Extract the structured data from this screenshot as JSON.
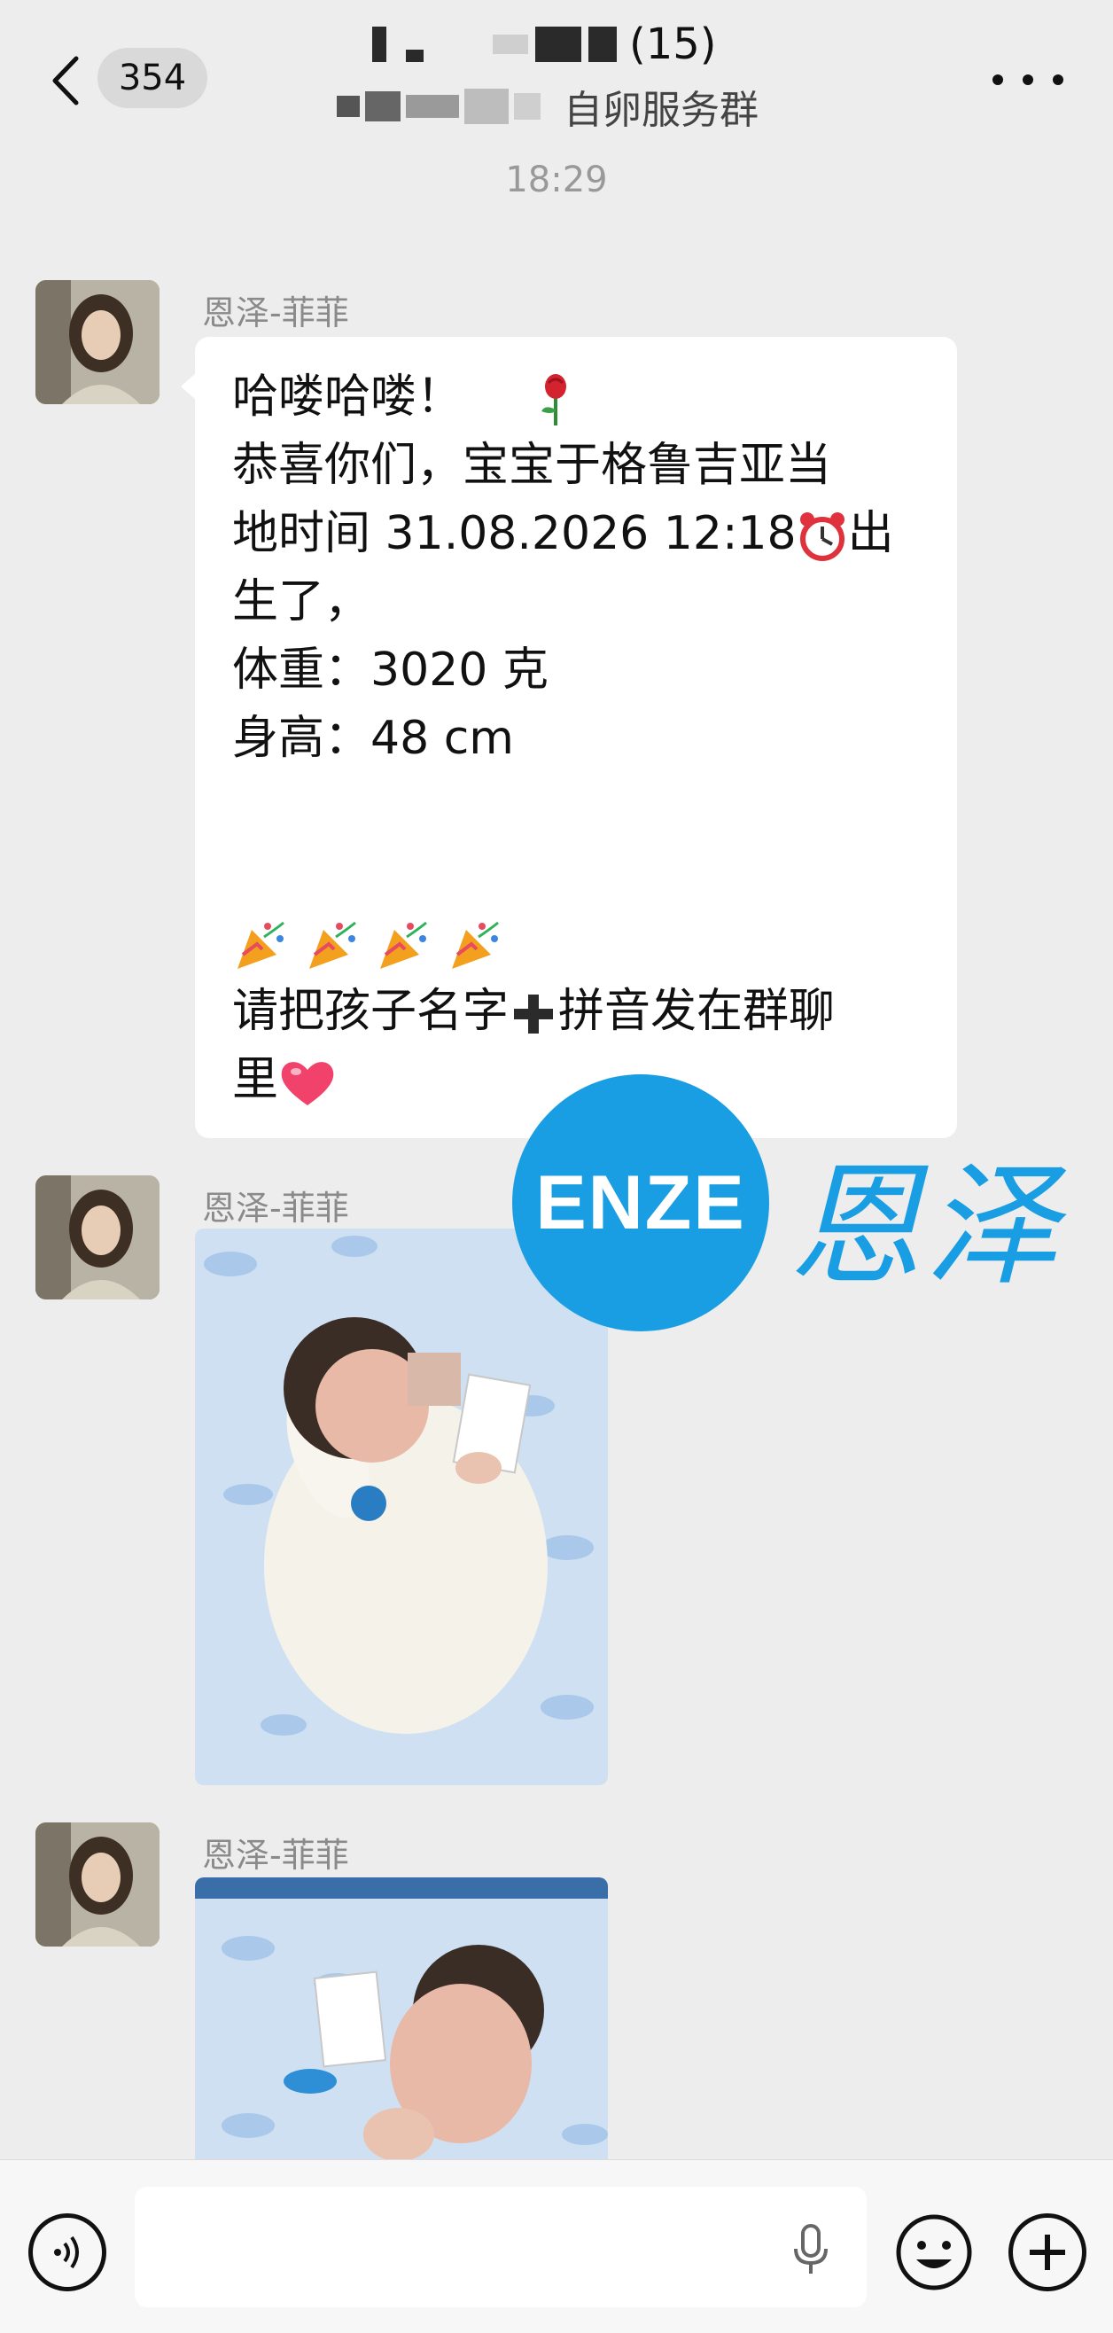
{
  "header": {
    "unread_count": "354",
    "title_count": "(15)",
    "title_sub": "自卵服务群",
    "back_icon": "chevron-left-icon",
    "more_icon": "more-dots-icon"
  },
  "chat": {
    "timestamp": "18:29",
    "messages": [
      {
        "sender": "恩泽-菲菲",
        "type": "text",
        "lines": [
          "哈喽哈喽！",
          "恭喜你们，宝宝于格鲁吉亚当",
          "地时间 31.08.2026 12:18",
          "生了，",
          "体重：3020 克",
          "身高：48 cm",
          "",
          "",
          "",
          "请把孩子名字",
          "里"
        ],
        "inline_suffix_3": "出",
        "inline_mid_10": "拼音发在群聊"
      },
      {
        "sender": "恩泽-菲菲",
        "type": "image"
      },
      {
        "sender": "恩泽-菲菲",
        "type": "image"
      }
    ]
  },
  "watermark": {
    "logo_text": "ENZE",
    "brand_text": "恩泽",
    "color": "#1a9ee3"
  },
  "inputbar": {
    "placeholder": ""
  },
  "colors": {
    "background": "#ededed",
    "bubble": "#ffffff",
    "sender": "#8a8a8a",
    "brand_blue": "#1a9ee3"
  }
}
